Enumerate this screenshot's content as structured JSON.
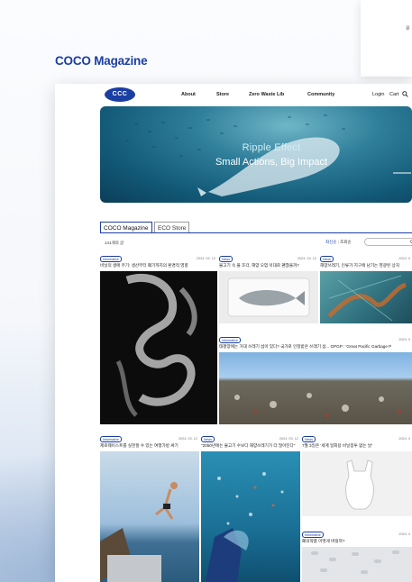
{
  "brand": "COCO Magazine",
  "back_card_text": "유",
  "nav": {
    "logo": "CCC",
    "items": [
      "About",
      "Store",
      "Zero Waste Lib",
      "Community"
    ],
    "login": "Login",
    "cart": "Cart"
  },
  "hero": {
    "line1": "Ripple Effect",
    "line2": "Small Actions, Big Impact"
  },
  "tabs": [
    "COCO Magazine",
    "ECO Store"
  ],
  "list": {
    "count": "141개의 글",
    "sort_active": "최신순",
    "sort_other": "조회순",
    "search_icon": "search-icon"
  },
  "posts": [
    {
      "badge": "Informative",
      "date": "2024. 03. 12",
      "title": "비닐의 생애 주기: 생산부터 폐기까지의 환경적 영향"
    },
    {
      "badge": "News",
      "date": "2024. 03. 12",
      "title": "물고기 속 플 조각, 해양 오염 이대로 괜찮을까?"
    },
    {
      "badge": "News",
      "date": "2024. 0",
      "title": "해양쓰레기, 인류가 지구에 남기는 영광된 상처"
    },
    {
      "badge": "Informative",
      "date": "2024. 0",
      "title": "태평양에는 거대 쓰레기 섬이 있다? 국가로 인정받은 쓰레기 섬... GPGP : 'Great Pacific Garbage P"
    },
    {
      "badge": "Informative",
      "date": "2024. 03. 12",
      "title": "제로웨이스트를 실천할 수 있는 여행가방 싸기"
    },
    {
      "badge": "News",
      "date": "2024. 03. 12",
      "title": "\"2050년에는 물고기 수보다 해양쓰레기가 더 많아진다\""
    },
    {
      "badge": "News",
      "date": "2024. 0",
      "title": "7월 3일은 '세계 일회용 비닐봉투 없는 날'"
    },
    {
      "badge": "Informative",
      "date": "2024. 0",
      "title": "폐의약품 어떻게 버릴까?"
    }
  ],
  "colors": {
    "accent": "#1b3ea3"
  }
}
